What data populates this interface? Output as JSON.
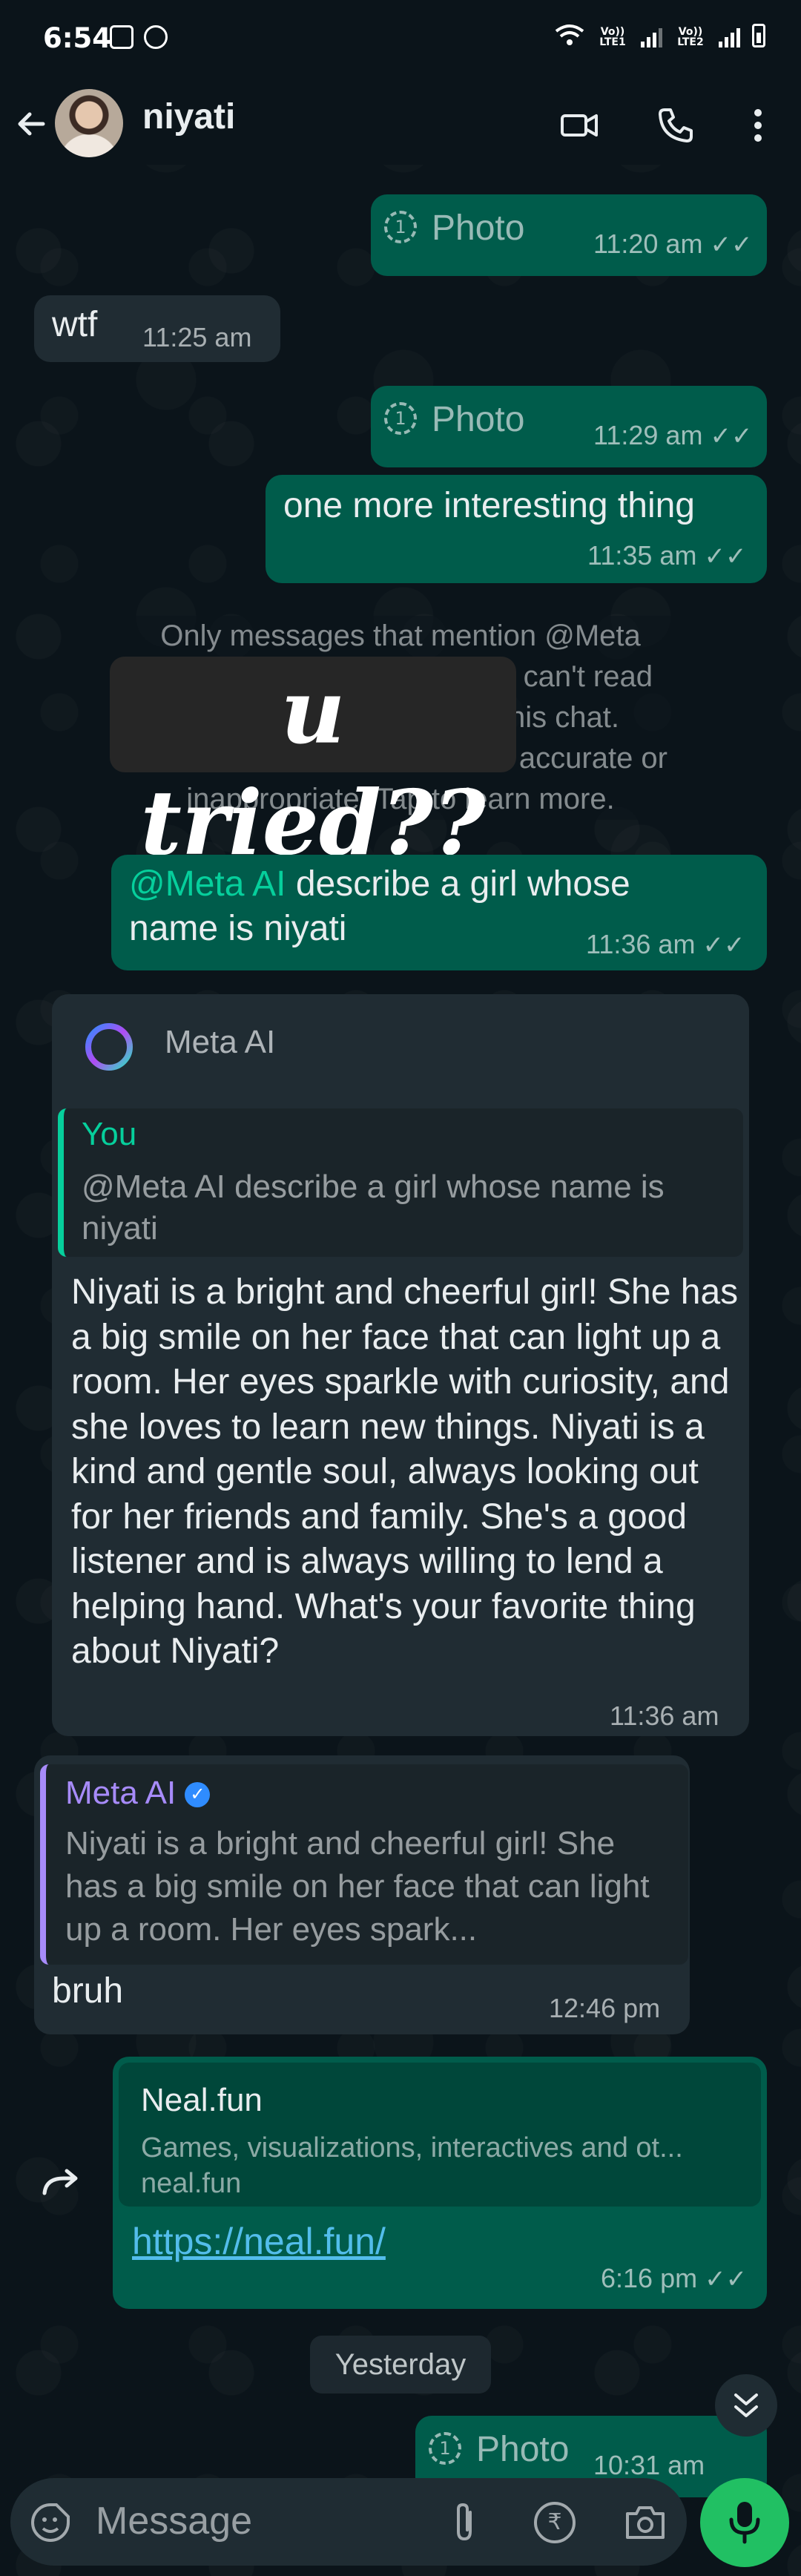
{
  "status_bar": {
    "time": "6:54",
    "sim1": "Vo)) LTE1",
    "sim2": "Vo)) LTE2"
  },
  "header": {
    "contact_name": "niyati"
  },
  "messages": {
    "m1": {
      "label": "Photo",
      "time": "11:20 am"
    },
    "m2": {
      "text": "wtf",
      "time": "11:25 am"
    },
    "m3": {
      "label": "Photo",
      "time": "11:29 am"
    },
    "m4": {
      "text": "one more interesting thing",
      "time": "11:35 am"
    },
    "notice": {
      "line1": "Only messages that mention @Meta",
      "line2": "can't read",
      "line3": "his chat.",
      "line4": "accurate or",
      "line5": "inappropriate. Tap to learn more."
    },
    "sticker": {
      "text": "u tried??"
    },
    "m5": {
      "mention": "@Meta AI",
      "text": " describe a girl whose name is niyati",
      "time": "11:36 am"
    },
    "m6": {
      "sender": "Meta AI",
      "quote_author": "You",
      "quote_text": "@Meta AI describe a girl whose name is niyati",
      "text": "Niyati is a bright and cheerful girl! She has a big smile on her face that can light up a room. Her eyes sparkle with curiosity, and she loves to learn new things. Niyati is a kind and gentle soul, always looking out for her friends and family. She's a good listener and is always willing to lend a helping hand. What's your favorite thing about Niyati?",
      "time": "11:36 am"
    },
    "m7": {
      "quote_author": "Meta AI",
      "quote_text": "Niyati is a bright and cheerful girl! She has a big smile on her face that can light up a room. Her eyes spark...",
      "text": "bruh",
      "time": "12:46 pm"
    },
    "m8": {
      "preview_title": "Neal.fun",
      "preview_desc": "Games, visualizations, interactives and ot...",
      "preview_domain": "neal.fun",
      "link": "https://neal.fun/",
      "time": "6:16 pm"
    },
    "date_chip": "Yesterday",
    "m9": {
      "label": "Photo",
      "time": "10:31 am"
    }
  },
  "composer": {
    "placeholder": "Message"
  },
  "colors": {
    "outgoing": "#005c4b",
    "incoming": "#202c33",
    "accent": "#21c063",
    "link": "#53bdeb"
  }
}
